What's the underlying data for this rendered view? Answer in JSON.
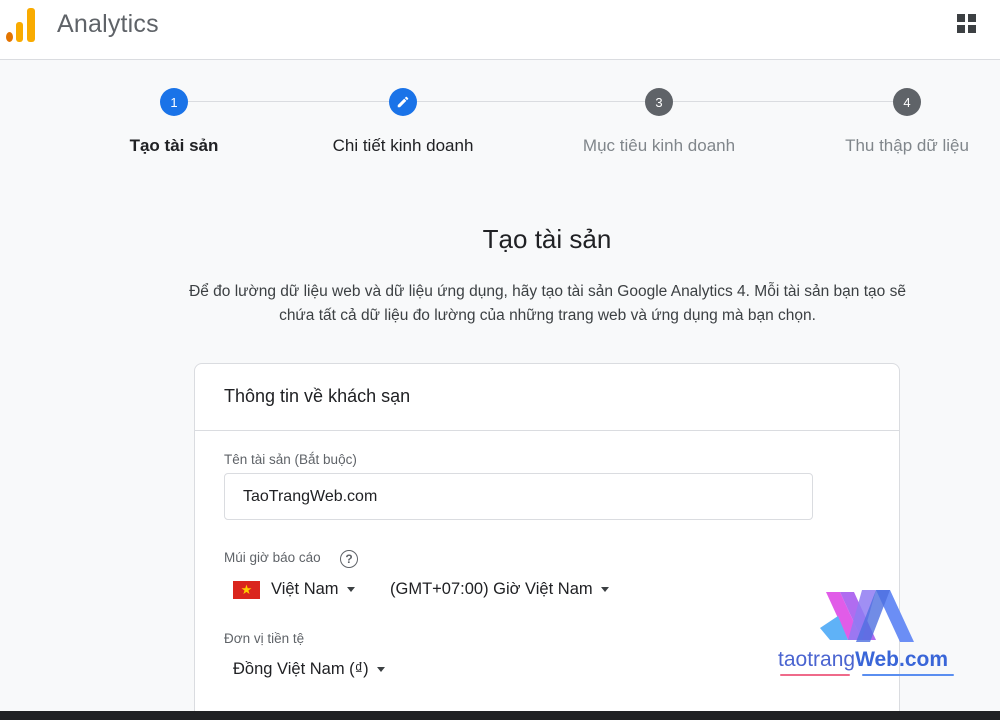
{
  "header": {
    "app_title": "Analytics",
    "apps_icon": "apps-grid-icon"
  },
  "stepper": {
    "steps": [
      {
        "number": "1",
        "label": "Tạo tài sản",
        "state": "active"
      },
      {
        "number": "",
        "label": "Chi tiết kinh doanh",
        "state": "editing",
        "icon": "pencil-icon"
      },
      {
        "number": "3",
        "label": "Mục tiêu kinh doanh",
        "state": "pending"
      },
      {
        "number": "4",
        "label": "Thu thập dữ liệu",
        "state": "pending"
      }
    ]
  },
  "page": {
    "title": "Tạo tài sản",
    "description_line1": "Để đo lường dữ liệu web và dữ liệu ứng dụng, hãy tạo tài sản Google Analytics 4. Mỗi tài sản bạn tạo sẽ",
    "description_line2": "chứa tất cả dữ liệu đo lường của những trang web và ứng dụng mà bạn chọn."
  },
  "card": {
    "header": "Thông tin về khách sạn",
    "property_name": {
      "label": "Tên tài sản (Bắt buộc)",
      "value": "TaoTrangWeb.com"
    },
    "timezone": {
      "label": "Múi giờ báo cáo",
      "help_icon": "help-circle-icon",
      "help_glyph": "?",
      "country": "Việt Nam",
      "zone": "(GMT+07:00) Giờ Việt Nam"
    },
    "currency": {
      "label": "Đơn vị tiền tệ",
      "value": "Đồng Việt Nam (₫)"
    }
  },
  "watermark": {
    "text_plain": "taotrang",
    "text_strong": "Web.com"
  },
  "colors": {
    "accent": "#1a73e8",
    "pending_step": "#5f6368",
    "logo_dark_orange": "#e37400",
    "logo_orange": "#f9ab00",
    "flag_red": "#da251d",
    "flag_star": "#ffcd00"
  }
}
